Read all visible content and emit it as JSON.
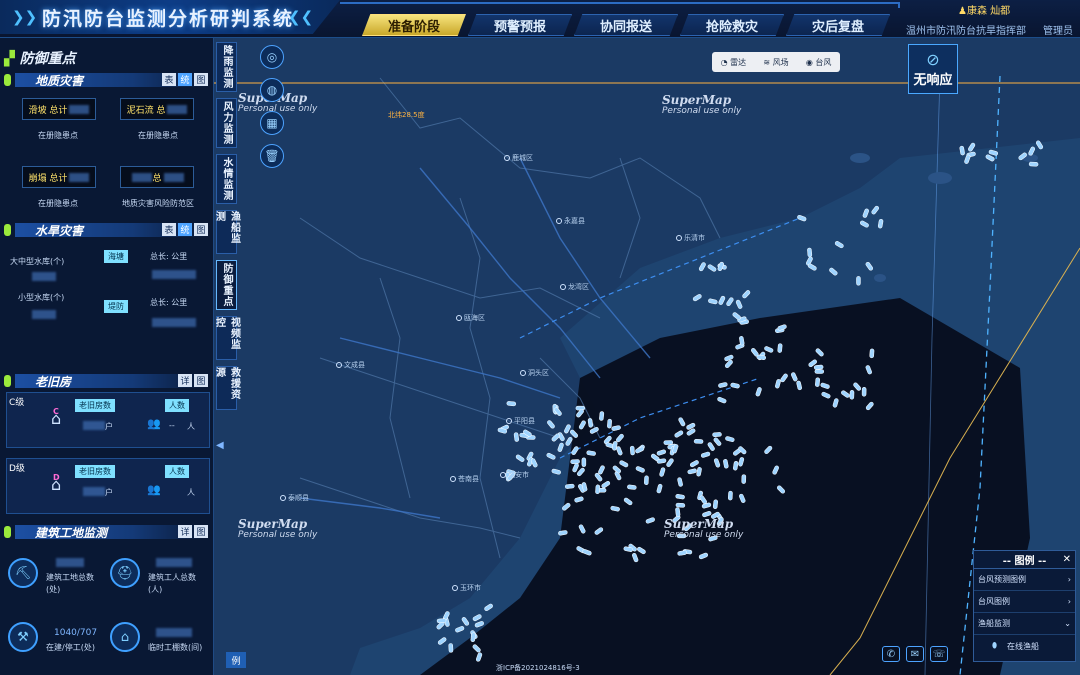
{
  "header": {
    "title": "防汛防台监测分析研判系统",
    "tabs": [
      {
        "label": "准备阶段",
        "active": true
      },
      {
        "label": "预警预报",
        "active": false
      },
      {
        "label": "协同报送",
        "active": false
      },
      {
        "label": "抢险救灾",
        "active": false
      },
      {
        "label": "灾后复盘",
        "active": false
      }
    ],
    "user_name": "康森 灿都",
    "org": "温州市防汛防台抗旱指挥部",
    "admin": "管理员"
  },
  "left": {
    "panel_title": "防御重点",
    "geo": {
      "title": "地质灾害",
      "buttons": [
        "表",
        "统",
        "图"
      ],
      "boxes": [
        {
          "label": "滑坡 总计",
          "caption": "在册隐患点"
        },
        {
          "label": "泥石流 总",
          "caption": "在册隐患点"
        },
        {
          "label": "崩塌 总计",
          "caption": "在册隐患点"
        },
        {
          "label": "总",
          "caption": "地质灾害风险防范区"
        }
      ]
    },
    "water": {
      "title": "水旱灾害",
      "buttons": [
        "表",
        "统",
        "图"
      ],
      "rows": [
        {
          "label": "大中型水库(个)",
          "tag": "海塘",
          "total": "总长: 公里"
        },
        {
          "label": "小型水库(个)",
          "tag": "堤防",
          "total": "总长: 公里"
        }
      ]
    },
    "old": {
      "title": "老旧房",
      "buttons": [
        "详",
        "图"
      ],
      "cards": [
        {
          "cls": "C级",
          "badge": "C",
          "count_label": "老旧房数",
          "count_unit": "户",
          "people_label": "人数",
          "people_value": "--",
          "people_unit": "人"
        },
        {
          "cls": "D级",
          "badge": "D",
          "count_label": "老旧房数",
          "count_unit": "户",
          "people_label": "人数",
          "people_value": "",
          "people_unit": "人"
        }
      ]
    },
    "build": {
      "title": "建筑工地监测",
      "buttons": [
        "详",
        "图"
      ],
      "stats": [
        {
          "caption1": "建筑工地总数",
          "caption2": "(处)"
        },
        {
          "caption1": "建筑工人总数",
          "caption2": "(人)"
        },
        {
          "caption1": "在建/停工(处)",
          "value": "1040/707"
        },
        {
          "caption1": "临时工棚数(间)"
        }
      ]
    },
    "legend_btn": "例"
  },
  "side_tabs": [
    "降雨监测",
    "风力监测",
    "水情监测",
    "渔船监测",
    "防御重点",
    "视频监控",
    "救援资源"
  ],
  "side_tabs_active": "防御重点",
  "map": {
    "layers": [
      "雷达",
      "风场",
      "台风"
    ],
    "no_response": "无响应",
    "lat_label": "北纬28.5度",
    "watermark_brand": "SuperMap",
    "watermark_sub": "Personal use only",
    "cities": [
      "瑞安市",
      "苍南县",
      "平阳县",
      "龙湾区",
      "鹿城区",
      "永嘉县",
      "乐清市",
      "瓯海区",
      "文成县",
      "泰顺县",
      "洞头区",
      "玉环市"
    ],
    "icp": "浙ICP备2021024816号-3"
  },
  "legend": {
    "title": "-- 图例 --",
    "rows": [
      "台风预测图例",
      "台风图例",
      "渔船监测",
      "在线渔船"
    ]
  },
  "colors": {
    "accent": "#4da3ff",
    "active_tab": "#f6e37d",
    "ship": "#9fd4ff",
    "land": "#1b3a64",
    "sea": "#070e1e"
  }
}
